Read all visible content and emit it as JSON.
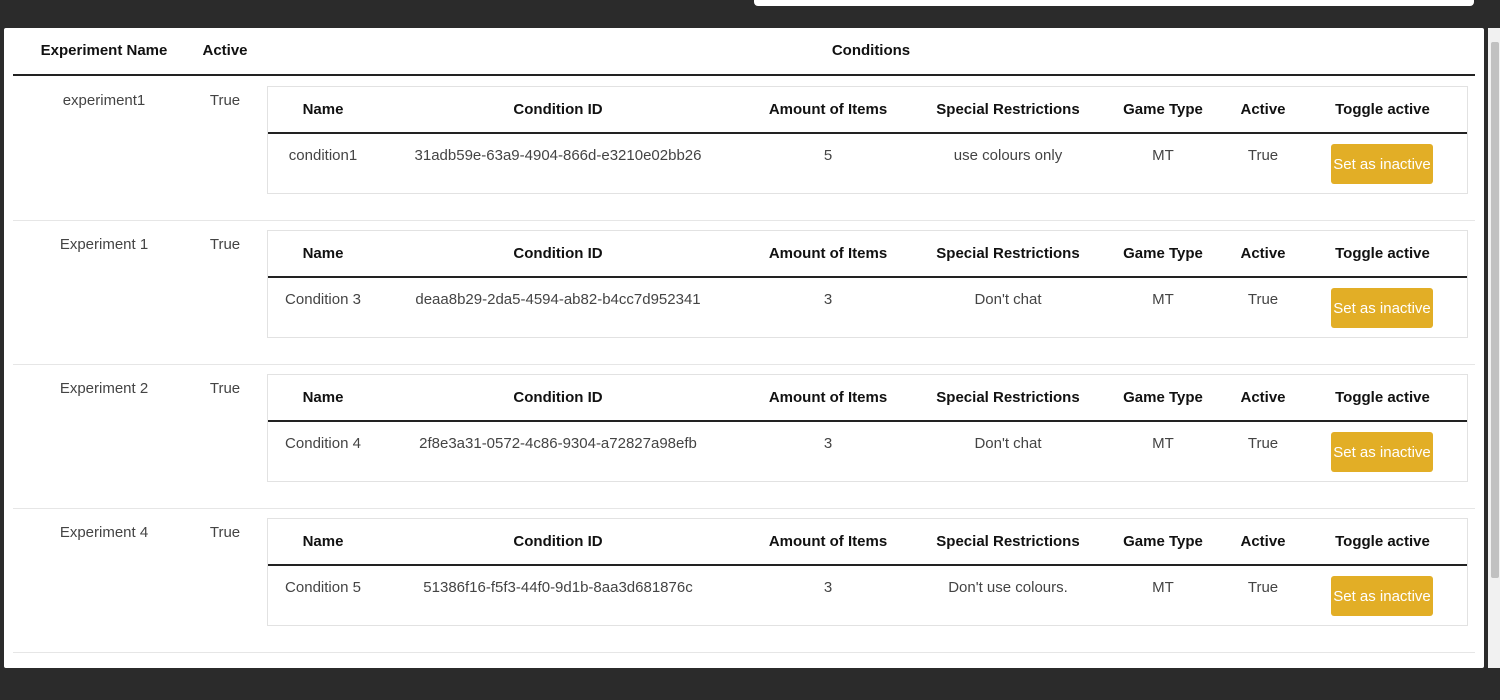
{
  "table": {
    "headers": {
      "experiment_name": "Experiment Name",
      "active": "Active",
      "conditions": "Conditions"
    },
    "condition_headers": {
      "name": "Name",
      "condition_id": "Condition ID",
      "amount_of_items": "Amount of Items",
      "special_restrictions": "Special Restrictions",
      "game_type": "Game Type",
      "active": "Active",
      "toggle_active": "Toggle active"
    },
    "experiments": [
      {
        "name": "experiment1",
        "active": "True",
        "condition": {
          "name": "condition1",
          "id": "31adb59e-63a9-4904-866d-e3210e02bb26",
          "amount": "5",
          "restrictions": "use colours only",
          "game_type": "MT",
          "active": "True",
          "button": "Set as inactive"
        }
      },
      {
        "name": "Experiment 1",
        "active": "True",
        "condition": {
          "name": "Condition 3",
          "id": "deaa8b29-2da5-4594-ab82-b4cc7d952341",
          "amount": "3",
          "restrictions": "Don't chat",
          "game_type": "MT",
          "active": "True",
          "button": "Set as inactive"
        }
      },
      {
        "name": "Experiment 2",
        "active": "True",
        "condition": {
          "name": "Condition 4",
          "id": "2f8e3a31-0572-4c86-9304-a72827a98efb",
          "amount": "3",
          "restrictions": "Don't chat",
          "game_type": "MT",
          "active": "True",
          "button": "Set as inactive"
        }
      },
      {
        "name": "Experiment 4",
        "active": "True",
        "condition": {
          "name": "Condition 5",
          "id": "51386f16-f5f3-44f0-9d1b-8aa3d681876c",
          "amount": "3",
          "restrictions": "Don't use colours.",
          "game_type": "MT",
          "active": "True",
          "button": "Set as inactive"
        }
      }
    ]
  },
  "colors": {
    "background": "#2b2b2b",
    "panel": "#ffffff",
    "button": "#e2ae26",
    "header_rule": "#222222"
  }
}
